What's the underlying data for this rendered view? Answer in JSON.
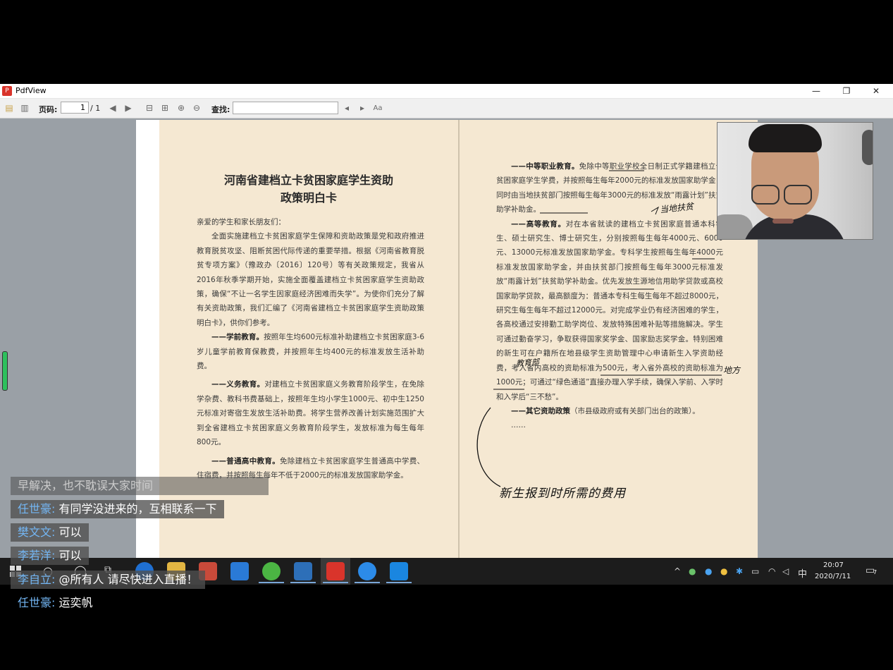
{
  "window": {
    "title": "PdfView",
    "minimize": "—",
    "restore": "❐",
    "close": "✕"
  },
  "toolbar": {
    "page_label": "页码:",
    "page_value": "1",
    "page_total": "/ 1",
    "find_label": "查找:",
    "find_value": ""
  },
  "document": {
    "left": {
      "title_line1": "河南省建档立卡贫困家庭学生资助",
      "title_line2": "政策明白卡",
      "greeting": "亲爱的学生和家长朋友们：",
      "intro": "全面实施建档立卡贫困家庭学生保障和资助政策是党和政府推进教育脱贫攻坚、阻断贫困代际传递的重要举措。根据《河南省教育脱贫专项方案》（豫政办〔2016〕120号）等有关政策规定，我省从2016年秋季学期开始，实施全面覆盖建档立卡贫困家庭学生资助政策，确保“不让一名学生因家庭经济困难而失学”。为使你们充分了解有关资助政策，我们汇编了《河南省建档立卡贫困家庭学生资助政策明白卡》，供你们参考。",
      "preschool_head": "——学前教育。",
      "preschool": "按照年生均600元标准补助建档立卡贫困家庭3-6岁儿童学前教育保教费，并按照年生均400元的标准发放生活补助费。",
      "compulsory_head": "——义务教育。",
      "compulsory": "对建档立卡贫困家庭义务教育阶段学生，在免除学杂费、教科书费基础上，按照年生均小学生1000元、初中生1250元标准对寄宿生发放生活补助费。将学生营养改善计划实施范围扩大到全省建档立卡贫困家庭义务教育阶段学生，发放标准为每生每年800元。",
      "highschool_head": "——普通高中教育。",
      "highschool": "免除建档立卡贫困家庭学生普通高中学费、住宿费，并按照每生每年不低于2000元的标准发放国家助学金。"
    },
    "right": {
      "vocational_head": "——中等职业教育。",
      "vocational": "免除中等职业学校全日制正式学籍建档立卡贫困家庭学生学费，并按照每生每年2000元的标准发放国家助学金，同时由当地扶贫部门按照每生每年3000元的标准发放“雨露计划”扶贫助学补助金。",
      "higher_head": "——高等教育。",
      "higher": "对在本省就读的建档立卡贫困家庭普通本科学生、硕士研究生、博士研究生，分别按照每生每年4000元、6000元、13000元标准发放国家助学金。专科学生按照每生每年4000元标准发放国家助学金，并由扶贫部门按照每生每年3000元标准发放“雨露计划”扶贫助学补助金。优先发放生源地信用助学贷款或高校国家助学贷款，最高额度为：普通本专科生每生每年不超过8000元，研究生每生每年不超过12000元。对完成学业仍有经济困难的学生，各高校通过安排勤工助学岗位、发放特殊困难补贴等措施解决。学生可通过勤奋学习，争取获得国家奖学金、国家励志奖学金。特别困难的新生可在户籍所在地县级学生资助管理中心申请新生入学资助经费，考入省内高校的资助标准为500元，考入省外高校的资助标准为1000元；可通过“绿色通道”直接办理入学手续，确保入学前、入学时和入学后“三不愁”。",
      "other_head": "——其它资助政策",
      "other": "（市县级政府或有关部门出台的政策）。",
      "dots": "……",
      "hw_1": "当地扶贫",
      "hw_2": "教育部",
      "hw_3": "地方",
      "hw_4": "新生报到时所需的费用"
    }
  },
  "taskbar": {
    "time": "20:07",
    "date": "2020/7/11",
    "ime": "中",
    "notif_count": "7"
  },
  "chat": [
    {
      "name": "",
      "text": "早解决，也不耽误大家时间"
    },
    {
      "name": "任世豪:",
      "text": "有同学没进来的，互相联系一下"
    },
    {
      "name": "樊文文:",
      "text": "可以"
    },
    {
      "name": "李若洋:",
      "text": "可以"
    },
    {
      "name": "李自立:",
      "text": "@所有人 请尽快进入直播！"
    },
    {
      "name": "任世豪:",
      "text": "运奕帆"
    }
  ],
  "colors": {
    "paper": "#f5e8d2",
    "chat_name": "#74b7f5",
    "taskbar": "#1c1c1c"
  }
}
